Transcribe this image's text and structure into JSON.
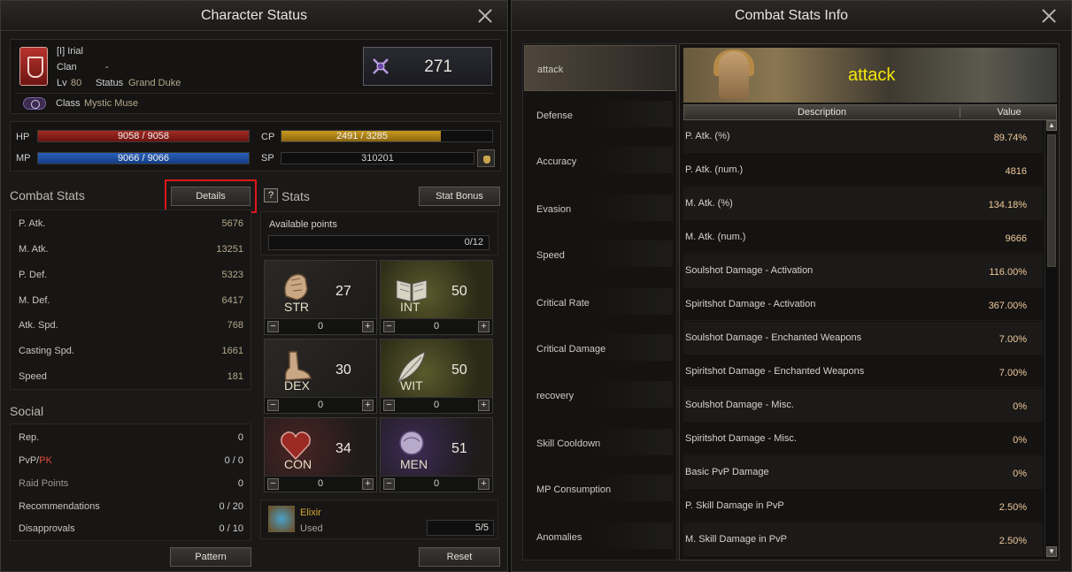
{
  "left": {
    "title": "Character Status",
    "char": {
      "name": "[I] Irial",
      "clan_label": "Clan",
      "clan_value": "-",
      "lv_label": "Lv",
      "lv_value": "80",
      "status_label": "Status",
      "status_value": "Grand Duke",
      "class_label": "Class",
      "class_value": "Mystic Muse",
      "score": "271"
    },
    "bars": {
      "hp_label": "HP",
      "hp_text": "9058 / 9058",
      "hp_fraction": 1.0,
      "mp_label": "MP",
      "mp_text": "9066 / 9066",
      "mp_fraction": 1.0,
      "cp_label": "CP",
      "cp_text": "2491 / 3285",
      "cp_fraction": 0.758,
      "sp_label": "SP",
      "sp_text": "310201"
    },
    "combat": {
      "title": "Combat Stats",
      "details_label": "Details",
      "rows": [
        {
          "k": "P. Atk.",
          "v": "5676"
        },
        {
          "k": "M. Atk.",
          "v": "13251"
        },
        {
          "k": "P. Def.",
          "v": "5323"
        },
        {
          "k": "M. Def.",
          "v": "6417"
        },
        {
          "k": "Atk. Spd.",
          "v": "768"
        },
        {
          "k": "Casting Spd.",
          "v": "1661"
        },
        {
          "k": "Speed",
          "v": "181"
        }
      ]
    },
    "social": {
      "title": "Social",
      "rep_k": "Rep.",
      "rep_v": "0",
      "pvp_k1": "PvP/",
      "pvp_k2": "PK",
      "pvp_v": "0 / 0",
      "raid_k": "Raid Points",
      "raid_v": "0",
      "rec_k": "Recommendations",
      "rec_v": "0 / 20",
      "dis_k": "Disapprovals",
      "dis_v": "0 / 10",
      "pattern_label": "Pattern"
    },
    "stats": {
      "title": "Stats",
      "bonus_label": "Stat Bonus",
      "question": "?",
      "available_label": "Available points",
      "available_value": "0/12",
      "cells": [
        {
          "name": "STR",
          "value": "27",
          "sub": "0"
        },
        {
          "name": "INT",
          "value": "50",
          "sub": "0"
        },
        {
          "name": "DEX",
          "value": "30",
          "sub": "0"
        },
        {
          "name": "WIT",
          "value": "50",
          "sub": "0"
        },
        {
          "name": "CON",
          "value": "34",
          "sub": "0"
        },
        {
          "name": "MEN",
          "value": "51",
          "sub": "0"
        }
      ],
      "minus": "−",
      "plus": "+",
      "elixir_name": "Elixir",
      "elixir_state": "Used",
      "elixir_count": "5/5",
      "reset_label": "Reset"
    }
  },
  "right": {
    "title": "Combat Stats Info",
    "categories": [
      "attack",
      "Defense",
      "Accuracy",
      "Evasion",
      "Speed",
      "Critical Rate",
      "Critical Damage",
      "recovery",
      "Skill Cooldown",
      "MP Consumption",
      "Anomalies"
    ],
    "banner_title": "attack",
    "col_desc": "Description",
    "col_value": "Value",
    "rows": [
      {
        "k": "P. Atk. (%)",
        "v": "89.74%"
      },
      {
        "k": "P. Atk. (num.)",
        "v": "4816"
      },
      {
        "k": "M. Atk. (%)",
        "v": "134.18%"
      },
      {
        "k": "M. Atk. (num.)",
        "v": "9666"
      },
      {
        "k": "Soulshot Damage - Activation",
        "v": "116.00%"
      },
      {
        "k": "Spiritshot Damage - Activation",
        "v": "367.00%"
      },
      {
        "k": "Soulshot Damage - Enchanted Weapons",
        "v": "7.00%"
      },
      {
        "k": "Spiritshot Damage - Enchanted Weapons",
        "v": "7.00%"
      },
      {
        "k": "Soulshot Damage - Misc.",
        "v": "0%"
      },
      {
        "k": "Spiritshot Damage - Misc.",
        "v": "0%"
      },
      {
        "k": "Basic PvP Damage",
        "v": "0%"
      },
      {
        "k": "P. Skill Damage in PvP",
        "v": "2.50%"
      },
      {
        "k": "M. Skill Damage in PvP",
        "v": "2.50%"
      }
    ]
  }
}
